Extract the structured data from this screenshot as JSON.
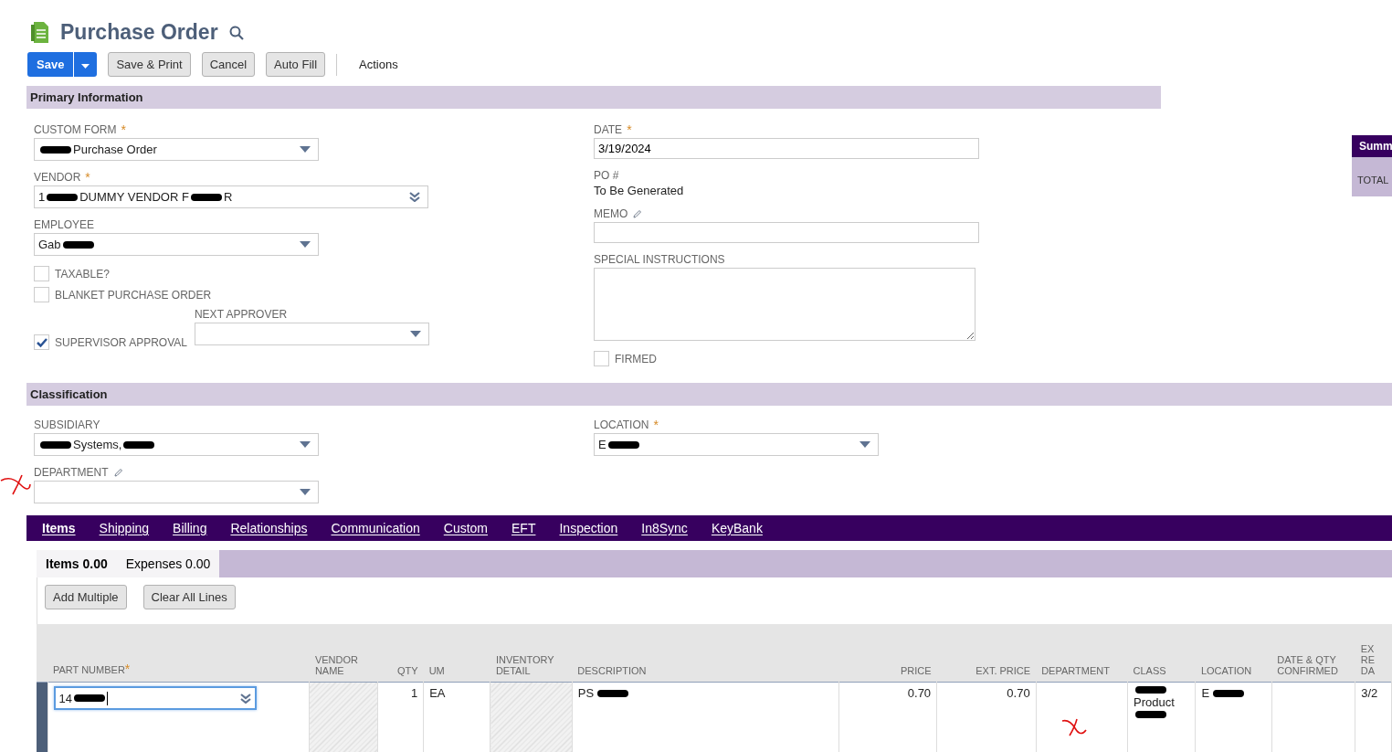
{
  "page": {
    "title": "Purchase Order"
  },
  "toolbar": {
    "buttons": [
      {
        "label": "Save",
        "kind": "primary"
      },
      {
        "label": "Save & Print",
        "kind": "secondary"
      },
      {
        "label": "Cancel",
        "kind": "secondary"
      },
      {
        "label": "Auto Fill",
        "kind": "secondary"
      }
    ],
    "menu": "Actions"
  },
  "primary_information": {
    "title": "Primary Information",
    "left": [
      {
        "kind": "select",
        "label": "CUSTOM FORM",
        "required_mark": "*",
        "value": [
          {
            "kind": "redaction"
          },
          {
            "kind": "text",
            "text": "Purchase Order"
          }
        ]
      },
      {
        "kind": "combo",
        "label": "VENDOR",
        "required_mark": "*",
        "value": [
          {
            "kind": "text",
            "text": "1"
          },
          {
            "kind": "redaction"
          },
          {
            "kind": "text",
            "text": "DUMMY VENDOR F"
          },
          {
            "kind": "redaction"
          },
          {
            "kind": "text",
            "text": "R"
          }
        ]
      },
      {
        "kind": "select",
        "label": "EMPLOYEE",
        "value": [
          {
            "kind": "text",
            "text": "Gab"
          },
          {
            "kind": "redaction"
          }
        ]
      },
      {
        "kind": "checkbox",
        "label": "TAXABLE?",
        "checked": false
      },
      {
        "kind": "checkbox",
        "label": "BLANKET PURCHASE ORDER",
        "checked": false
      },
      {
        "kind": "approval",
        "label": "SUPERVISOR APPROVAL",
        "checked": true,
        "select_label": "NEXT APPROVER"
      }
    ],
    "right": [
      {
        "kind": "input",
        "label": "DATE",
        "required_mark": "*",
        "value": "3/19/2024"
      },
      {
        "kind": "static",
        "label": "PO #",
        "value": "To Be Generated"
      },
      {
        "kind": "input",
        "label": "MEMO",
        "editable": true
      },
      {
        "kind": "textarea",
        "label": "SPECIAL INSTRUCTIONS"
      },
      {
        "kind": "checkbox",
        "label": "FIRMED",
        "checked": false
      }
    ]
  },
  "summary": {
    "title": "Summ",
    "row": "TOTAL"
  },
  "classification": {
    "title": "Classification",
    "left": [
      {
        "kind": "select",
        "label": "SUBSIDIARY",
        "value": [
          {
            "kind": "redaction"
          },
          {
            "kind": "text",
            "text": "Systems,"
          },
          {
            "kind": "redaction"
          }
        ]
      },
      {
        "kind": "select",
        "label": "DEPARTMENT",
        "editable": true
      }
    ],
    "right": [
      {
        "kind": "select",
        "label": "LOCATION",
        "required_mark": "*",
        "value": [
          {
            "kind": "text",
            "text": "E"
          },
          {
            "kind": "redaction"
          }
        ]
      }
    ]
  },
  "tabs": [
    {
      "label": "Items",
      "selected": true
    },
    {
      "label": "Shipping",
      "selected": false
    },
    {
      "label": "Billing",
      "selected": false
    },
    {
      "label": "Relationships",
      "selected": false
    },
    {
      "label": "Communication",
      "selected": false
    },
    {
      "label": "Custom",
      "selected": false
    },
    {
      "label": "EFT",
      "selected": false
    },
    {
      "label": "Inspection",
      "selected": false
    },
    {
      "label": "In8Sync",
      "selected": false
    },
    {
      "label": "KeyBank",
      "selected": false
    }
  ],
  "subtabs": [
    {
      "label": "Items 0.00",
      "selected": true
    },
    {
      "label": "Expenses 0.00",
      "selected": false
    }
  ],
  "line_buttons": [
    "Add Multiple",
    "Clear All Lines"
  ],
  "table": {
    "columns": [
      {
        "lines": [
          "PART NUMBER"
        ],
        "required_mark": "*"
      },
      {
        "lines": [
          "VENDOR",
          "NAME"
        ]
      },
      {
        "lines": [
          "QTY"
        ]
      },
      {
        "lines": [
          "UM"
        ]
      },
      {
        "lines": [
          "INVENTORY",
          "DETAIL"
        ]
      },
      {
        "lines": [
          "DESCRIPTION"
        ]
      },
      {
        "lines": [
          "PRICE"
        ]
      },
      {
        "lines": [
          "EXT. PRICE"
        ]
      },
      {
        "lines": [
          "DEPARTMENT"
        ]
      },
      {
        "lines": [
          "CLASS"
        ]
      },
      {
        "lines": [
          "LOCATION"
        ]
      },
      {
        "lines": [
          "DATE & QTY",
          "CONFIRMED"
        ]
      },
      {
        "lines": [
          "EX",
          "RE",
          "DA"
        ]
      }
    ],
    "rows": [
      {
        "cells": [
          {
            "kind": "edit",
            "value": [
              {
                "kind": "text",
                "text": "14"
              },
              {
                "kind": "redaction"
              }
            ]
          },
          {
            "kind": "disabled"
          },
          {
            "kind": "text",
            "value": [
              {
                "kind": "text",
                "text": "1"
              }
            ]
          },
          {
            "kind": "text",
            "value": [
              {
                "kind": "text",
                "text": "EA"
              }
            ]
          },
          {
            "kind": "disabled"
          },
          {
            "kind": "text",
            "value": [
              {
                "kind": "text",
                "text": "PS"
              },
              {
                "kind": "redaction"
              }
            ]
          },
          {
            "kind": "text",
            "value": [
              {
                "kind": "text",
                "text": "0.70"
              }
            ]
          },
          {
            "kind": "text",
            "value": [
              {
                "kind": "text",
                "text": "0.70"
              }
            ]
          },
          {
            "kind": "text"
          },
          {
            "kind": "text",
            "value": [
              {
                "kind": "redaction"
              },
              {
                "kind": "text",
                "text": "Product"
              },
              {
                "kind": "redaction"
              }
            ]
          },
          {
            "kind": "text",
            "value": [
              {
                "kind": "text",
                "text": "E"
              },
              {
                "kind": "redaction"
              }
            ]
          },
          {
            "kind": "text"
          },
          {
            "kind": "text",
            "value": [
              {
                "kind": "text",
                "text": "3/2"
              }
            ]
          }
        ]
      }
    ]
  }
}
